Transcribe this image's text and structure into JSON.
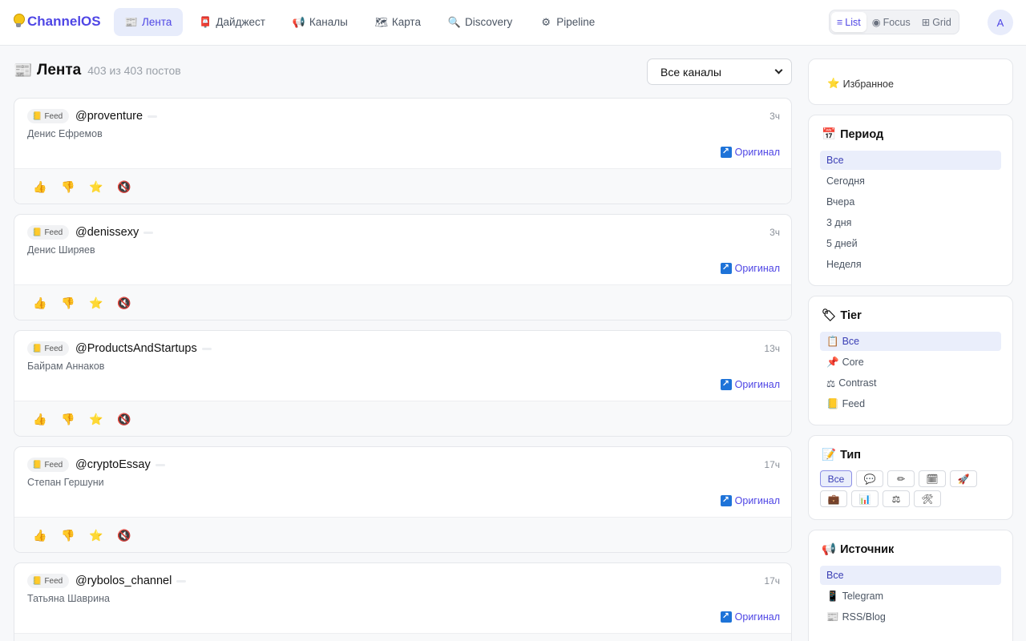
{
  "app": {
    "name": "ChannelOS",
    "avatar_letter": "A"
  },
  "nav": [
    {
      "label": "Лента",
      "icon": "📰",
      "icon_name": "newspaper-icon",
      "active": true
    },
    {
      "label": "Дайджест",
      "icon": "📮",
      "icon_name": "postbox-icon",
      "active": false
    },
    {
      "label": "Каналы",
      "icon": "📢",
      "icon_name": "megaphone-icon",
      "active": false
    },
    {
      "label": "Карта",
      "icon": "🗺",
      "icon_name": "map-icon",
      "active": false
    },
    {
      "label": "Discovery",
      "icon": "🔍",
      "icon_name": "search-icon",
      "active": false
    },
    {
      "label": "Pipeline",
      "icon": "⚙",
      "icon_name": "gear-icon",
      "active": false
    }
  ],
  "view_modes": [
    {
      "label": "List",
      "icon": "≡",
      "active": true
    },
    {
      "label": "Focus",
      "icon": "◉",
      "active": false
    },
    {
      "label": "Grid",
      "icon": "⊞",
      "active": false
    }
  ],
  "feed": {
    "title": "Лента",
    "count_text": "403 из 403 постов",
    "channel_filter": "Все каналы"
  },
  "posts": [
    {
      "tier": "Feed",
      "handle": "@proventure",
      "author": "Денис Ефремов",
      "time": "3ч",
      "original_label": "Оригинал"
    },
    {
      "tier": "Feed",
      "handle": "@denissexy",
      "author": "Денис Ширяев",
      "time": "3ч",
      "original_label": "Оригинал"
    },
    {
      "tier": "Feed",
      "handle": "@ProductsAndStartups",
      "author": "Байрам Аннаков",
      "time": "13ч",
      "original_label": "Оригинал"
    },
    {
      "tier": "Feed",
      "handle": "@cryptoEssay",
      "author": "Степан Гершуни",
      "time": "17ч",
      "original_label": "Оригинал"
    },
    {
      "tier": "Feed",
      "handle": "@rybolos_channel",
      "author": "Татьяна Шаврина",
      "time": "17ч",
      "original_label": "Оригинал"
    }
  ],
  "sidebar": {
    "favorites_label": "Избранное",
    "period": {
      "title": "Период",
      "options": [
        "Все",
        "Сегодня",
        "Вчера",
        "3 дня",
        "5 дней",
        "Неделя"
      ]
    },
    "tier": {
      "title": "Tier",
      "options": [
        {
          "label": "Все",
          "icon": "📋"
        },
        {
          "label": "Core",
          "icon": "📌"
        },
        {
          "label": "Contrast",
          "icon": "⚖"
        },
        {
          "label": "Feed",
          "icon": "📒"
        }
      ]
    },
    "type": {
      "title": "Тип",
      "all_label": "Все",
      "chips": [
        "💬",
        "✏",
        "🗓",
        "🚀",
        "💼",
        "📊",
        "⚖",
        "🛠"
      ]
    },
    "source": {
      "title": "Источник",
      "options": [
        {
          "label": "Все",
          "icon": ""
        },
        {
          "label": "Telegram",
          "icon": "📱"
        },
        {
          "label": "RSS/Blog",
          "icon": "📰"
        }
      ]
    }
  }
}
